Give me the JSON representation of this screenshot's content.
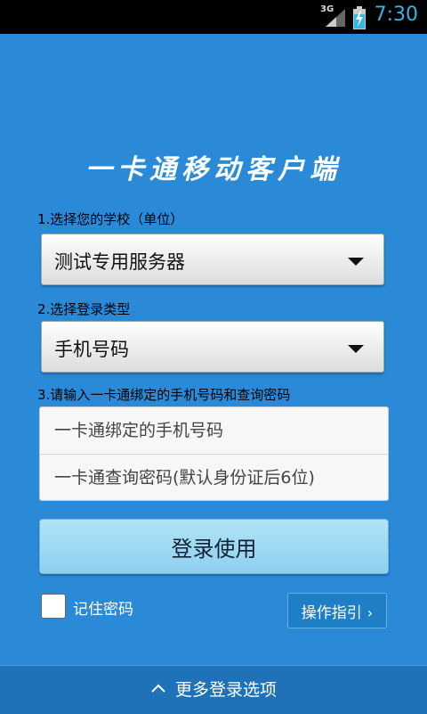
{
  "status_bar": {
    "network": "3G",
    "time": "7:30"
  },
  "app": {
    "title": "一卡通移动客户端"
  },
  "form": {
    "school_label": "1.选择您的学校（单位）",
    "school_selected": "测试专用服务器",
    "login_type_label": "2.选择登录类型",
    "login_type_selected": "手机号码",
    "credentials_label": "3.请输入一卡通绑定的手机号码和查询密码",
    "phone_placeholder": "一卡通绑定的手机号码",
    "password_placeholder": "一卡通查询密码(默认身份证后6位)",
    "login_button": "登录使用",
    "remember_label": "记住密码",
    "guide_button": "操作指引"
  },
  "bottom_bar": {
    "label": "更多登录选项"
  },
  "colors": {
    "background": "#2a8ad8",
    "status_time": "#33b5e5",
    "login_button": "#a6dcf6"
  }
}
